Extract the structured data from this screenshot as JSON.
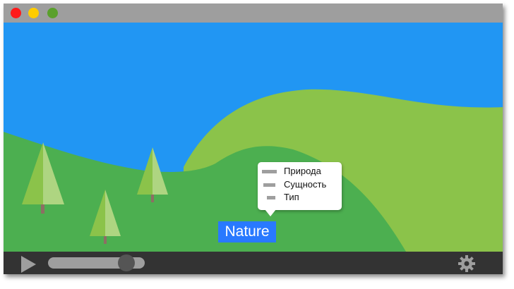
{
  "window": {
    "buttons": [
      "close",
      "minimize",
      "maximize"
    ],
    "colors": {
      "titlebar": "#9e9e9e",
      "sky": "#2196F3",
      "hill_dark": "#4caf50",
      "hill_light": "#8bc34a",
      "controls": "#333333"
    }
  },
  "popup_menu": {
    "items": [
      {
        "label": "Природа"
      },
      {
        "label": "Сущность"
      },
      {
        "label": "Тип"
      }
    ]
  },
  "tag": {
    "label": "Nature",
    "color": "#2979ff"
  },
  "player": {
    "play_icon": "play-icon",
    "settings_icon": "gear-icon",
    "progress": 0.88
  }
}
